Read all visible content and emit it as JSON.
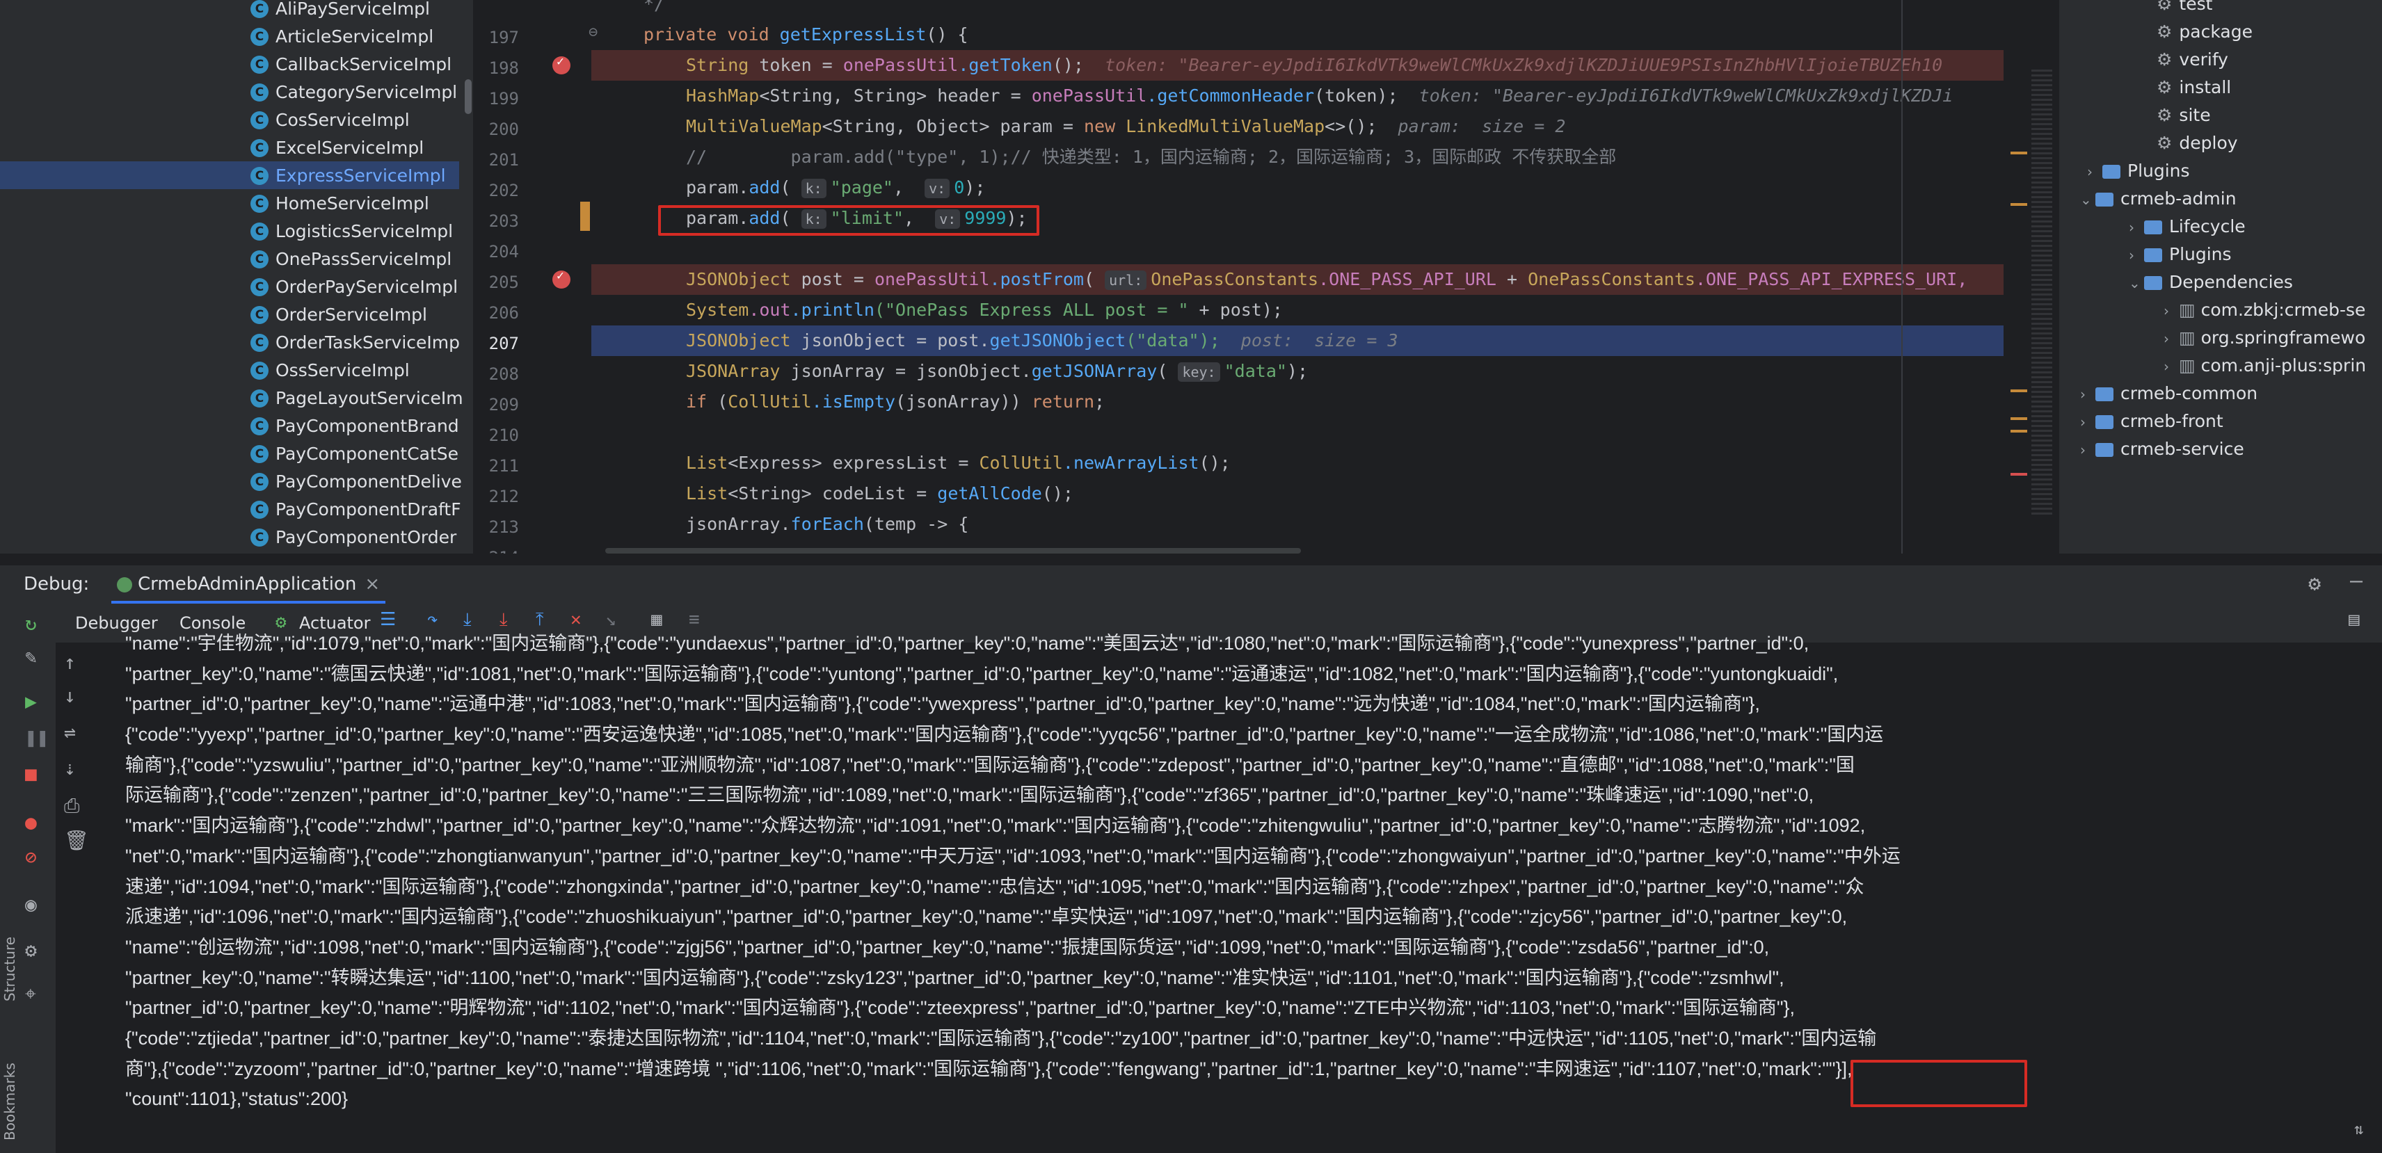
{
  "project_tree": {
    "items": [
      {
        "label": "AliPayServiceImpl"
      },
      {
        "label": "ArticleServiceImpl"
      },
      {
        "label": "CallbackServiceImpl"
      },
      {
        "label": "CategoryServiceImpl"
      },
      {
        "label": "CosServiceImpl"
      },
      {
        "label": "ExcelServiceImpl"
      },
      {
        "label": "ExpressServiceImpl",
        "selected": true
      },
      {
        "label": "HomeServiceImpl"
      },
      {
        "label": "LogisticsServiceImpl"
      },
      {
        "label": "OnePassServiceImpl"
      },
      {
        "label": "OrderPayServiceImpl"
      },
      {
        "label": "OrderServiceImpl"
      },
      {
        "label": "OrderTaskServiceImp"
      },
      {
        "label": "OssServiceImpl"
      },
      {
        "label": "PageLayoutServiceIm"
      },
      {
        "label": "PayComponentBrand"
      },
      {
        "label": "PayComponentCatSe"
      },
      {
        "label": "PayComponentDelive"
      },
      {
        "label": "PayComponentDraftF"
      },
      {
        "label": "PayComponentOrder"
      }
    ],
    "class_icon_letter": "C"
  },
  "editor": {
    "line_numbers": [
      "",
      "197",
      "198",
      "199",
      "200",
      "201",
      "202",
      "203",
      "204",
      "205",
      "206",
      "207",
      "208",
      "209",
      "210",
      "211",
      "212",
      "213",
      "214"
    ],
    "line0": "*/",
    "l197": {
      "kw": "private void ",
      "fn": "getExpressList",
      "rest": "() {"
    },
    "l198": {
      "type": "String ",
      "var": "token = ",
      "field": "onePassUtil",
      "call": ".getToken",
      "end": "();",
      "hint": "token: \"Bearer-eyJpdiI6IkdVTk9weWlCMkUxZk9xdjlKZDJiUUE9PSIsInZhbHVlIjoieTBUZEh10"
    },
    "l199": {
      "type": "HashMap",
      "generic": "<String, String>",
      "var": " header = ",
      "field": "onePassUtil",
      "call": ".getCommonHeader",
      "end": "(token);",
      "hint": "token: \"Bearer-eyJpdiI6IkdVTk9weWlCMkUxZk9xdjlKZDJi"
    },
    "l200": {
      "type": "MultiValueMap",
      "generic": "<String, Object>",
      "var": " param = ",
      "kw": "new ",
      "cls": "LinkedMultiValueMap",
      "end": "<>();",
      "hint": "param:  size = 2"
    },
    "l201": {
      "comment": "//        param.add(\"type\", 1);// 快递类型: 1，国内运输商; 2，国际运输商; 3，国际邮政 不传获取全部"
    },
    "l202": {
      "pre": "param.",
      "fn": "add",
      "k_chip": "k:",
      "key": "\"page\"",
      "v_chip": "v:",
      "val": "0",
      "end": ");"
    },
    "l203": {
      "pre": "param.",
      "fn": "add",
      "k_chip": "k:",
      "key": "\"limit\"",
      "v_chip": "v:",
      "val": "9999",
      "end": ");"
    },
    "l205": {
      "type": "JSONObject ",
      "var": "post = ",
      "field": "onePassUtil",
      "call": ".postFrom",
      "chip": "url:",
      "cls1": "OnePassConstants",
      "c1": ".ONE_PASS_API_URL",
      "plus": " + ",
      "cls2": "OnePassConstants",
      "c2": ".ONE_PASS_API_EXPRESS_URI,"
    },
    "l206": {
      "cls": "System",
      "field": ".out",
      "fn": ".println",
      "str": "(\"OnePass Express ALL post = \"",
      "end": " + post);"
    },
    "l207": {
      "type": "JSONObject ",
      "var": "jsonObject = post.",
      "fn": "getJSONObject",
      "str": "(\"data\");",
      "hint": "post:  size = 3"
    },
    "l208": {
      "type": "JSONArray ",
      "var": "jsonArray = jsonObject.",
      "fn": "getJSONArray",
      "chip": "key:",
      "str": "\"data\"",
      "end": ");"
    },
    "l209": {
      "kw": "if ",
      "pre": "(",
      "cls": "CollUtil",
      "fn": ".isEmpty",
      "mid": "(jsonArray)) ",
      "kw2": "return",
      "end": ";"
    },
    "l211": {
      "type": "List",
      "generic": "<Express>",
      "var": " expressList = ",
      "cls": "CollUtil",
      "fn": ".newArrayList",
      "end": "();"
    },
    "l212": {
      "type": "List",
      "generic": "<String>",
      "var": " codeList = ",
      "fn": "getAllCode",
      "end": "();"
    },
    "l213": {
      "var": "jsonArray.",
      "fn": "forEach",
      "end": "(temp -> {"
    }
  },
  "maven_tree": {
    "items": [
      {
        "label": "test",
        "kind": "goal"
      },
      {
        "label": "package",
        "kind": "goal"
      },
      {
        "label": "verify",
        "kind": "goal"
      },
      {
        "label": "install",
        "kind": "goal"
      },
      {
        "label": "site",
        "kind": "goal"
      },
      {
        "label": "deploy",
        "kind": "goal"
      },
      {
        "label": "Plugins",
        "kind": "folder"
      },
      {
        "label": "crmeb-admin",
        "kind": "module"
      },
      {
        "label": "Lifecycle",
        "kind": "folder"
      },
      {
        "label": "Plugins",
        "kind": "folder"
      },
      {
        "label": "Dependencies",
        "kind": "folder"
      },
      {
        "label": "com.zbkj:crmeb-se",
        "kind": "lib"
      },
      {
        "label": "org.springframewo",
        "kind": "lib"
      },
      {
        "label": "com.anji-plus:sprin",
        "kind": "lib"
      },
      {
        "label": "crmeb-common",
        "kind": "module"
      },
      {
        "label": "crmeb-front",
        "kind": "module"
      },
      {
        "label": "crmeb-service",
        "kind": "module"
      }
    ]
  },
  "debug": {
    "title": "Debug:",
    "session_tab": "CrmebAdminApplication",
    "tabs": [
      "Debugger",
      "Console",
      "Actuator"
    ],
    "side_labels": [
      "Structure",
      "Bookmarks"
    ]
  },
  "console": {
    "lines": [
      "\"name\":\"宇佳物流\",\"id\":1079,\"net\":0,\"mark\":\"国内运输商\"},{\"code\":\"yundaexus\",\"partner_id\":0,\"partner_key\":0,\"name\":\"美国云达\",\"id\":1080,\"net\":0,\"mark\":\"国际运输商\"},{\"code\":\"yunexpress\",\"partner_id\":0,",
      "\"partner_key\":0,\"name\":\"德国云快递\",\"id\":1081,\"net\":0,\"mark\":\"国际运输商\"},{\"code\":\"yuntong\",\"partner_id\":0,\"partner_key\":0,\"name\":\"运通速运\",\"id\":1082,\"net\":0,\"mark\":\"国内运输商\"},{\"code\":\"yuntongkuaidi\",",
      "\"partner_id\":0,\"partner_key\":0,\"name\":\"运通中港\",\"id\":1083,\"net\":0,\"mark\":\"国内运输商\"},{\"code\":\"ywexpress\",\"partner_id\":0,\"partner_key\":0,\"name\":\"远为快递\",\"id\":1084,\"net\":0,\"mark\":\"国内运输商\"},",
      "{\"code\":\"yyexp\",\"partner_id\":0,\"partner_key\":0,\"name\":\"西安运逸快递\",\"id\":1085,\"net\":0,\"mark\":\"国内运输商\"},{\"code\":\"yyqc56\",\"partner_id\":0,\"partner_key\":0,\"name\":\"一运全成物流\",\"id\":1086,\"net\":0,\"mark\":\"国内运",
      "输商\"},{\"code\":\"yzswuliu\",\"partner_id\":0,\"partner_key\":0,\"name\":\"亚洲顺物流\",\"id\":1087,\"net\":0,\"mark\":\"国际运输商\"},{\"code\":\"zdepost\",\"partner_id\":0,\"partner_key\":0,\"name\":\"直德邮\",\"id\":1088,\"net\":0,\"mark\":\"国",
      "际运输商\"},{\"code\":\"zenzen\",\"partner_id\":0,\"partner_key\":0,\"name\":\"三三国际物流\",\"id\":1089,\"net\":0,\"mark\":\"国际运输商\"},{\"code\":\"zf365\",\"partner_id\":0,\"partner_key\":0,\"name\":\"珠峰速运\",\"id\":1090,\"net\":0,",
      "\"mark\":\"国内运输商\"},{\"code\":\"zhdwl\",\"partner_id\":0,\"partner_key\":0,\"name\":\"众辉达物流\",\"id\":1091,\"net\":0,\"mark\":\"国内运输商\"},{\"code\":\"zhitengwuliu\",\"partner_id\":0,\"partner_key\":0,\"name\":\"志腾物流\",\"id\":1092,",
      "\"net\":0,\"mark\":\"国内运输商\"},{\"code\":\"zhongtianwanyun\",\"partner_id\":0,\"partner_key\":0,\"name\":\"中天万运\",\"id\":1093,\"net\":0,\"mark\":\"国内运输商\"},{\"code\":\"zhongwaiyun\",\"partner_id\":0,\"partner_key\":0,\"name\":\"中外运",
      "速递\",\"id\":1094,\"net\":0,\"mark\":\"国际运输商\"},{\"code\":\"zhongxinda\",\"partner_id\":0,\"partner_key\":0,\"name\":\"忠信达\",\"id\":1095,\"net\":0,\"mark\":\"国内运输商\"},{\"code\":\"zhpex\",\"partner_id\":0,\"partner_key\":0,\"name\":\"众",
      "派速递\",\"id\":1096,\"net\":0,\"mark\":\"国内运输商\"},{\"code\":\"zhuoshikuaiyun\",\"partner_id\":0,\"partner_key\":0,\"name\":\"卓实快运\",\"id\":1097,\"net\":0,\"mark\":\"国内运输商\"},{\"code\":\"zjcy56\",\"partner_id\":0,\"partner_key\":0,",
      "\"name\":\"创运物流\",\"id\":1098,\"net\":0,\"mark\":\"国内运输商\"},{\"code\":\"zjgj56\",\"partner_id\":0,\"partner_key\":0,\"name\":\"振捷国际货运\",\"id\":1099,\"net\":0,\"mark\":\"国际运输商\"},{\"code\":\"zsda56\",\"partner_id\":0,",
      "\"partner_key\":0,\"name\":\"转瞬达集运\",\"id\":1100,\"net\":0,\"mark\":\"国内运输商\"},{\"code\":\"zsky123\",\"partner_id\":0,\"partner_key\":0,\"name\":\"准实快运\",\"id\":1101,\"net\":0,\"mark\":\"国内运输商\"},{\"code\":\"zsmhwl\",",
      "\"partner_id\":0,\"partner_key\":0,\"name\":\"明辉物流\",\"id\":1102,\"net\":0,\"mark\":\"国内运输商\"},{\"code\":\"zteexpress\",\"partner_id\":0,\"partner_key\":0,\"name\":\"ZTE中兴物流\",\"id\":1103,\"net\":0,\"mark\":\"国际运输商\"},",
      "{\"code\":\"ztjieda\",\"partner_id\":0,\"partner_key\":0,\"name\":\"泰捷达国际物流\",\"id\":1104,\"net\":0,\"mark\":\"国际运输商\"},{\"code\":\"zy100\",\"partner_id\":0,\"partner_key\":0,\"name\":\"中远快运\",\"id\":1105,\"net\":0,\"mark\":\"国内运输",
      "商\"},{\"code\":\"zyzoom\",\"partner_id\":0,\"partner_key\":0,\"name\":\"增速跨境 \",\"id\":1106,\"net\":0,\"mark\":\"国际运输商\"},{\"code\":\"fengwang\",\"partner_id\":1,\"partner_key\":0,\"name\":\"丰网速运\",\"id\":1107,\"net\":0,\"mark\":\"\"}],",
      "\"count\":1101},\"status\":200}"
    ]
  },
  "colors": {
    "highlight_box": "#d62b24",
    "breakpoint_line": "#4b2b2b",
    "execution_line": "#2d3e6b"
  }
}
